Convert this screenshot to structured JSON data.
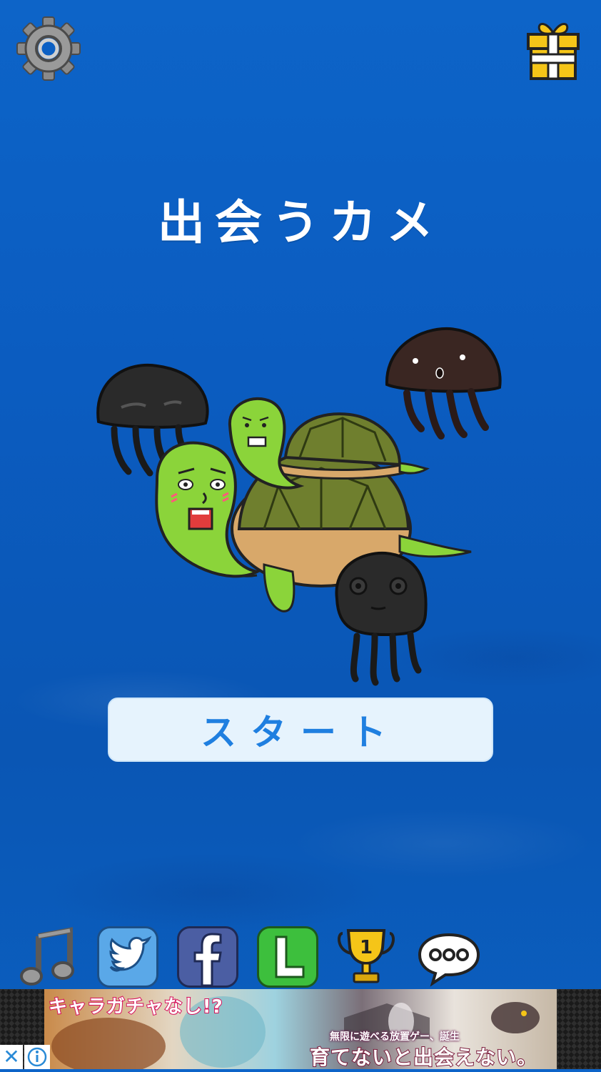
{
  "app": {
    "title": "出会うカメ"
  },
  "top_bar": {
    "settings_icon": "gear-icon",
    "gift_icon": "gift-icon"
  },
  "main": {
    "start_label": "スタート",
    "illustration": "turtles-and-jellyfish"
  },
  "bottom_bar": {
    "items": [
      {
        "name": "music",
        "icon": "music-note-icon"
      },
      {
        "name": "twitter",
        "icon": "twitter-bird-icon"
      },
      {
        "name": "facebook",
        "icon": "facebook-f-icon"
      },
      {
        "name": "line",
        "icon": "line-l-icon"
      },
      {
        "name": "ranking",
        "icon": "trophy-icon",
        "badge": "1"
      },
      {
        "name": "more",
        "icon": "speech-bubble-dots-icon"
      }
    ]
  },
  "ad": {
    "headline": "キャラガチャなし!?",
    "subline": "無限に遊べる放置ゲー、誕生",
    "main_copy": "育てないと出会えない。",
    "close_symbol": "✕"
  },
  "colors": {
    "ocean": "#0b5cc0",
    "start_button_bg": "#e6f3fd",
    "start_button_text": "#1f7fe0",
    "gift_yellow": "#f5c518"
  }
}
